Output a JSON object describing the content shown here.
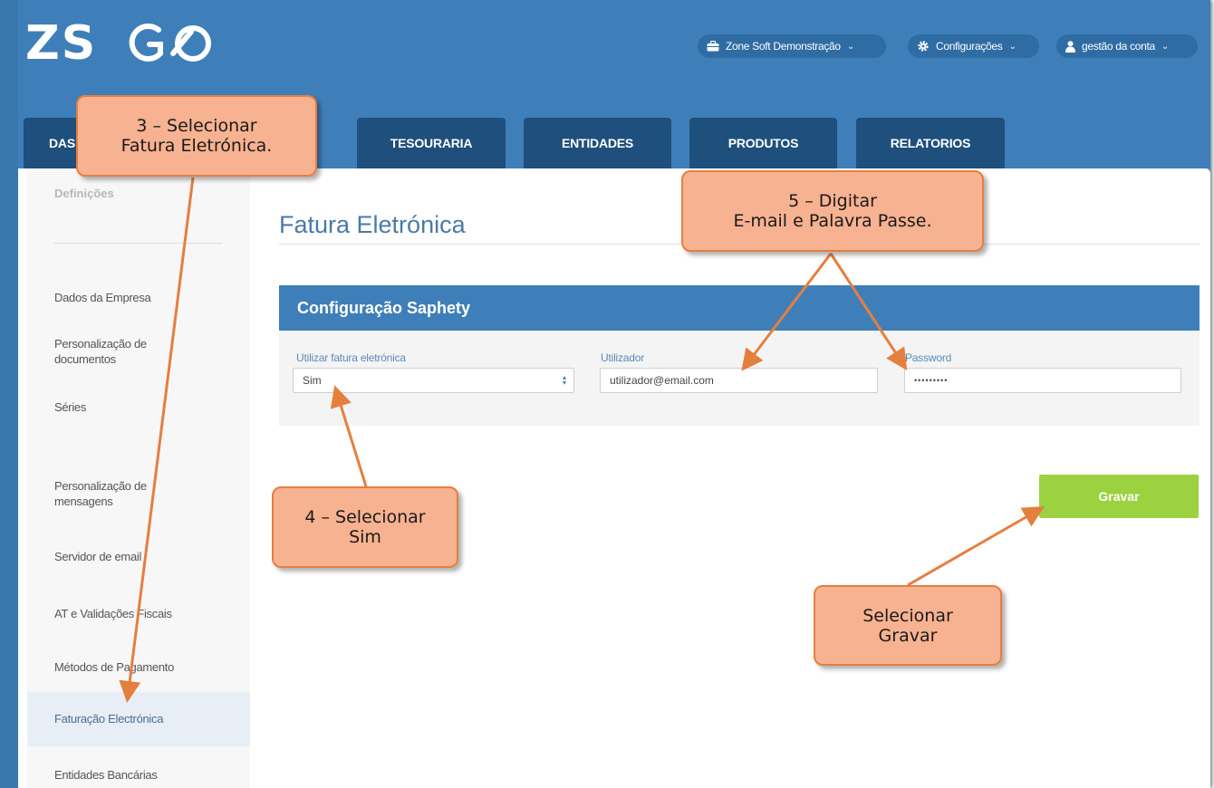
{
  "app": {
    "logo_text": "ZS",
    "logo_go": "GO"
  },
  "topbar": {
    "items": [
      {
        "label": "Zone Soft Demonstração",
        "icon": "briefcase-icon"
      },
      {
        "label": "Configurações",
        "icon": "gear-icon"
      },
      {
        "label": "gestão da conta",
        "icon": "user-icon"
      }
    ]
  },
  "tabs": [
    {
      "label": "DAS"
    },
    {
      "label": "TESOURARIA"
    },
    {
      "label": "ENTIDADES"
    },
    {
      "label": "PRODUTOS"
    },
    {
      "label": "RELATORIOS"
    }
  ],
  "sidebar": {
    "title": "Definições",
    "items": [
      {
        "label": "Dados da Empresa"
      },
      {
        "label": "Personalização de\ndocumentos"
      },
      {
        "label": "Séries"
      },
      {
        "label": "Personalização de\nmensagens"
      },
      {
        "label": "Servidor de email"
      },
      {
        "label": "AT e Validações Fiscais"
      },
      {
        "label": "Métodos de Pagamento"
      },
      {
        "label": "Faturação Electrónica",
        "active": true
      },
      {
        "label": "Entidades Bancárias"
      }
    ]
  },
  "main": {
    "title": "Fatura Eletrónica",
    "section_title": "Configuração Saphety",
    "fields": {
      "use_label": "Utilizar fatura eletrónica",
      "use_value": "Sim",
      "user_label": "Utilizador",
      "user_value": "utilizador@email.com",
      "password_label": "Password",
      "password_value": "•••••••••"
    },
    "save_label": "Gravar"
  },
  "callouts": {
    "step3": "3 – Selecionar\nFatura Eletrónica.",
    "step4": "4 – Selecionar\nSim",
    "step5": "5 – Digitar\nE-mail e Palavra Passe.",
    "save": "Selecionar\nGravar"
  },
  "colors": {
    "header_blue": "#3f7fb9",
    "tab_navy": "#1f4f7c",
    "save_green": "#9cd23f",
    "callout_fill": "#f7b291",
    "callout_border": "#e57f3e"
  }
}
